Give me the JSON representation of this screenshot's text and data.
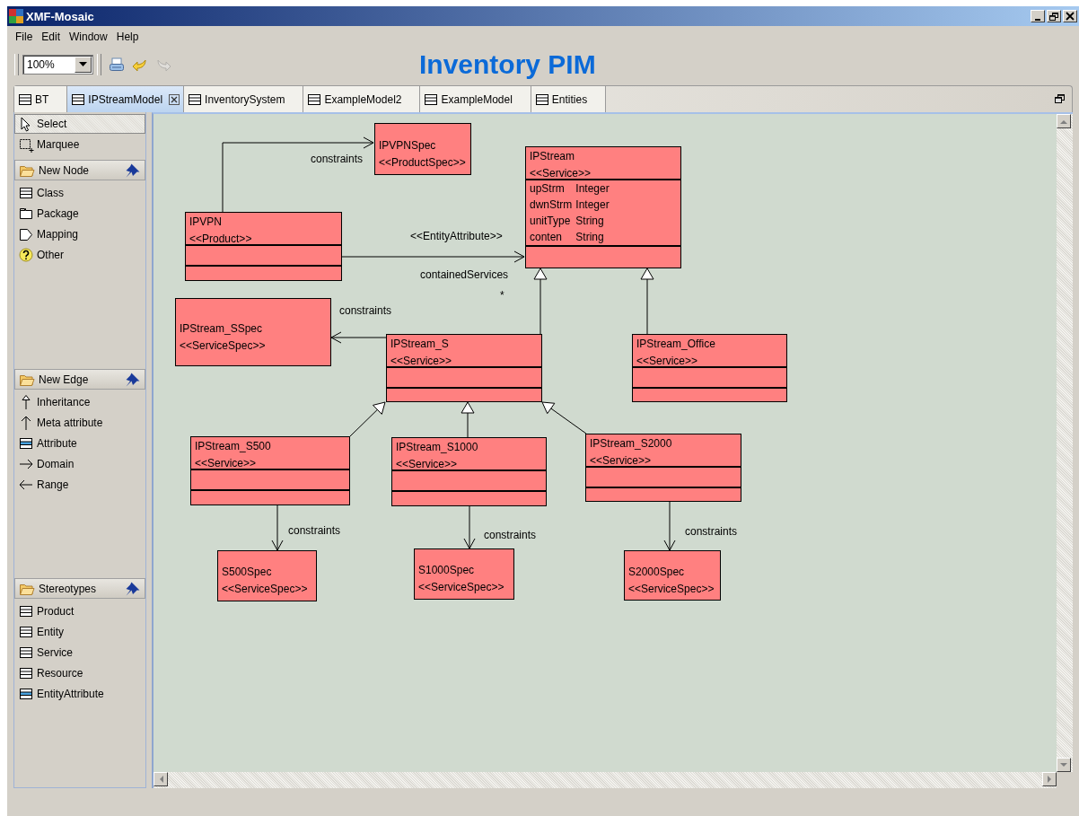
{
  "window": {
    "title": "XMF-Mosaic"
  },
  "menu": [
    "File",
    "Edit",
    "Window",
    "Help"
  ],
  "toolbar": {
    "zoom": "100%",
    "buttons": [
      {
        "kind": "print",
        "disabled": false
      },
      {
        "kind": "undo",
        "disabled": false
      },
      {
        "kind": "redo",
        "disabled": true
      }
    ]
  },
  "heading": "Inventory PIM",
  "tabs": [
    {
      "label": "BT",
      "selected": false
    },
    {
      "label": "IPStreamModel",
      "selected": true
    },
    {
      "label": "InventorySystem",
      "selected": false
    },
    {
      "label": "ExampleModel2",
      "selected": false
    },
    {
      "label": "ExampleModel",
      "selected": false
    },
    {
      "label": "Entities",
      "selected": false
    }
  ],
  "palette": {
    "tools": [
      {
        "label": "Select",
        "kind": "pointer",
        "selected": true
      },
      {
        "label": "Marquee",
        "kind": "marquee",
        "selected": false
      }
    ],
    "drawers": [
      {
        "label": "New Node",
        "pinned": true,
        "items": [
          {
            "label": "Class",
            "kind": "node"
          },
          {
            "label": "Package",
            "kind": "package"
          },
          {
            "label": "Mapping",
            "kind": "mapping"
          },
          {
            "label": "Other",
            "kind": "other"
          }
        ]
      },
      {
        "label": "New Edge",
        "pinned": true,
        "items": [
          {
            "label": "Inheritance",
            "kind": "inheritance"
          },
          {
            "label": "Meta attribute",
            "kind": "meta-attribute"
          },
          {
            "label": "Attribute",
            "kind": "attribute"
          },
          {
            "label": "Domain",
            "kind": "domain"
          },
          {
            "label": "Range",
            "kind": "range"
          }
        ]
      },
      {
        "label": "Stereotypes",
        "pinned": true,
        "items": [
          {
            "label": "Product",
            "kind": "node"
          },
          {
            "label": "Entity",
            "kind": "node"
          },
          {
            "label": "Service",
            "kind": "node"
          },
          {
            "label": "Resource",
            "kind": "node"
          },
          {
            "label": "EntityAttribute",
            "kind": "attribute"
          }
        ]
      }
    ]
  },
  "diagram": {
    "nodes": [
      {
        "kind": "spec",
        "name": "IPVPNSpec",
        "stereotype": "<<ProductSpec>>"
      },
      {
        "kind": "class",
        "name": "IPVPN",
        "stereotype": "<<Product>>"
      },
      {
        "kind": "class",
        "name": "IPStream",
        "stereotype": "<<Service>>",
        "attributes": [
          {
            "name": "upStrm",
            "type": "Integer"
          },
          {
            "name": "dwnStrm",
            "type": "Integer"
          },
          {
            "name": "unitType",
            "type": "String"
          },
          {
            "name": "conten",
            "type": "String"
          }
        ]
      },
      {
        "kind": "spec",
        "name": "IPStream_SSpec",
        "stereotype": "<<ServiceSpec>>"
      },
      {
        "kind": "class",
        "name": "IPStream_S",
        "stereotype": "<<Service>>"
      },
      {
        "kind": "class",
        "name": "IPStream_Office",
        "stereotype": "<<Service>>"
      },
      {
        "kind": "class",
        "name": "IPStream_S500",
        "stereotype": "<<Service>>"
      },
      {
        "kind": "class",
        "name": "IPStream_S1000",
        "stereotype": "<<Service>>"
      },
      {
        "kind": "class",
        "name": "IPStream_S2000",
        "stereotype": "<<Service>>"
      },
      {
        "kind": "spec",
        "name": "S500Spec",
        "stereotype": "<<ServiceSpec>>"
      },
      {
        "kind": "spec",
        "name": "S1000Spec",
        "stereotype": "<<ServiceSpec>>"
      },
      {
        "kind": "spec",
        "name": "S2000Spec",
        "stereotype": "<<ServiceSpec>>"
      }
    ],
    "edges": [
      {
        "kind": "association",
        "label": "constraints"
      },
      {
        "kind": "association",
        "stereotype": "<<EntityAttribute>>",
        "label": "containedServices",
        "multiplicity": "*"
      },
      {
        "kind": "association",
        "label": "constraints"
      },
      {
        "kind": "inheritance"
      },
      {
        "kind": "inheritance"
      },
      {
        "kind": "inheritance"
      },
      {
        "kind": "inheritance"
      },
      {
        "kind": "inheritance"
      },
      {
        "kind": "association",
        "label": "constraints"
      },
      {
        "kind": "association",
        "label": "constraints"
      },
      {
        "kind": "association",
        "label": "constraints"
      }
    ]
  }
}
